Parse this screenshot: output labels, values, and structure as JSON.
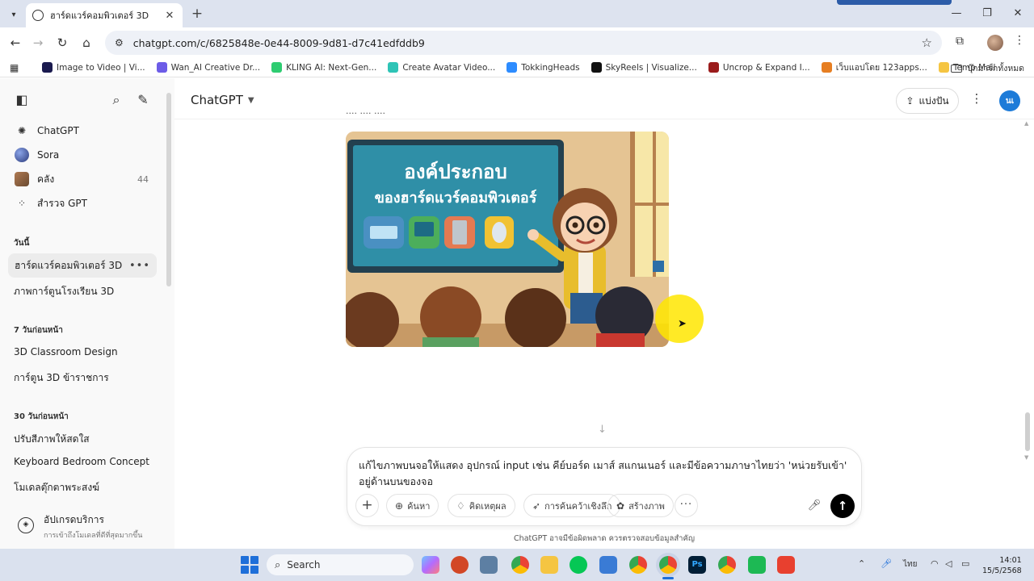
{
  "browser": {
    "tab_title": "ฮาร์ดแวร์คอมพิวเตอร์ 3D",
    "url": "chatgpt.com/c/6825848e-0e44-8009-9d81-d7c41edfddb9",
    "bookmarks": [
      {
        "label": "Image to Video | Vi...",
        "color": "#1a1a4e"
      },
      {
        "label": "Wan_AI Creative Dr...",
        "color": "#6c5ce7"
      },
      {
        "label": "KLING AI: Next-Gen...",
        "color": "#2ecc71"
      },
      {
        "label": "Create Avatar Video...",
        "color": "#2ec4b6"
      },
      {
        "label": "TokkingHeads",
        "color": "#2d8cff"
      },
      {
        "label": "SkyReels | Visualize...",
        "color": "#111111"
      },
      {
        "label": "Uncrop & Expand I...",
        "color": "#9b1c1c"
      },
      {
        "label": "เว็บแอปโดย 123apps...",
        "color": "#e67e22"
      },
      {
        "label": "Temp Mail",
        "color": "#f5c542"
      }
    ],
    "all_bookmarks": "บุ๊กมาร์กทั้งหมด"
  },
  "sidebar": {
    "top_items": [
      {
        "label": "ChatGPT",
        "icon": "openai-icon"
      },
      {
        "label": "Sora",
        "icon": "sora-icon"
      },
      {
        "label": "คลัง",
        "icon": "library-icon",
        "count": "44"
      },
      {
        "label": "สำรวจ GPT",
        "icon": "grid-icon"
      }
    ],
    "sections": [
      {
        "title": "วันนี้",
        "items": [
          "ฮาร์ดแวร์คอมพิวเตอร์ 3D",
          "ภาพการ์ตูนโรงเรียน 3D"
        ]
      },
      {
        "title": "7 วันก่อนหน้า",
        "items": [
          "3D Classroom Design",
          "การ์ตูน 3D ข้าราชการ"
        ]
      },
      {
        "title": "30 วันก่อนหน้า",
        "items": [
          "ปรับสีภาพให้สดใส",
          "Keyboard Bedroom Concept",
          "โมเดลตุ๊กตาพระสงฆ์"
        ]
      }
    ],
    "upgrade": {
      "title": "อัปเกรดบริการ",
      "subtitle": "การเข้าถึงโมเดลที่ดีที่สุดมากขึ้น"
    }
  },
  "main": {
    "model_name": "ChatGPT",
    "share_label": "แบ่งปัน",
    "user_initials": "นเ",
    "image_alt": {
      "headline_1": "องค์ประกอบ",
      "headline_2": "ของฮาร์ดแวร์คอมพิวเตอร์"
    },
    "composer": {
      "prompt": "แก้ไขภาพบนจอให้แสดง อุปกรณ์ input เช่น คีย์บอร์ด เมาส์ สแกนเนอร์  และมีข้อความภาษาไทยว่า 'หน่วยรับเข้า' อยู่ด้านบนของจอ",
      "buttons": [
        "ค้นหา",
        "คิดเหตุผล",
        "การค้นคว้าเชิงลึก",
        "สร้างภาพ"
      ]
    },
    "disclaimer": "ChatGPT อาจมีข้อผิดพลาด ควรตรวจสอบข้อมูลสำคัญ"
  },
  "taskbar": {
    "search_label": "Search",
    "ime": "ไทย",
    "time": "14:01",
    "date": "15/5/2568"
  }
}
